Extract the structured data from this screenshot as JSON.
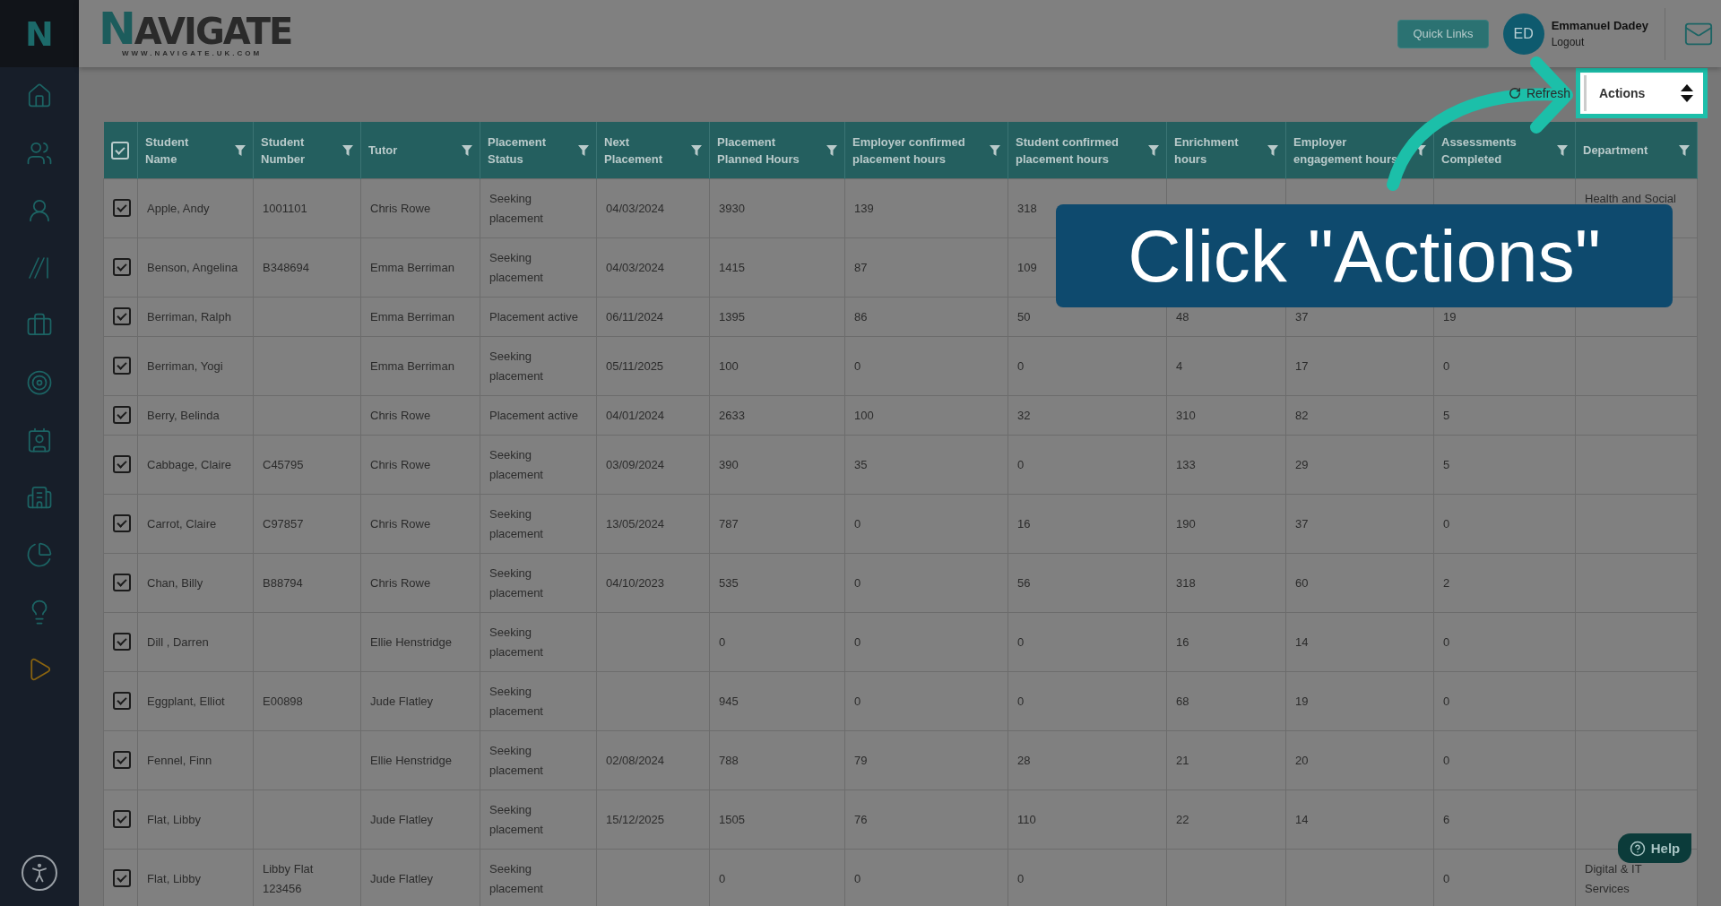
{
  "sidebar": {
    "logo": "N"
  },
  "header": {
    "logo": "NAVIGATE",
    "logo_url": "WWW.NAVIGATE.UK.COM",
    "quick_links": "Quick Links",
    "user": {
      "initials": "ED",
      "name": "Emmanuel Dadey",
      "logout": "Logout"
    }
  },
  "toolbar": {
    "refresh": "Refresh",
    "actions": "Actions"
  },
  "table": {
    "select_all_checked": true,
    "columns": [
      "Student Name",
      "Student Number",
      "Tutor",
      "Placement Status",
      "Next Placement",
      "Placement Planned Hours",
      "Employer confirmed placement hours",
      "Student confirmed placement hours",
      "Enrichment hours",
      "Employer engagement hours",
      "Assessments Completed",
      "Department"
    ],
    "rows": [
      {
        "checked": true,
        "cells": [
          "Apple, Andy",
          "1001101",
          "Chris Rowe",
          "Seeking placement",
          "04/03/2024",
          "3930",
          "139",
          "318",
          null,
          null,
          null,
          "Health and Social"
        ]
      },
      {
        "checked": true,
        "cells": [
          "Benson, Angelina",
          "B348694",
          "Emma Berriman",
          "Seeking placement",
          "04/03/2024",
          "1415",
          "87",
          "109",
          null,
          null,
          null,
          null
        ]
      },
      {
        "checked": true,
        "cells": [
          "Berriman, Ralph",
          null,
          "Emma Berriman",
          "Placement active",
          "06/11/2024",
          "1395",
          "86",
          "50",
          "48",
          "37",
          "19",
          null
        ]
      },
      {
        "checked": true,
        "cells": [
          "Berriman, Yogi",
          null,
          "Emma Berriman",
          "Seeking placement",
          "05/11/2025",
          "100",
          "0",
          "0",
          "4",
          "17",
          "0",
          null
        ]
      },
      {
        "checked": true,
        "cells": [
          "Berry, Belinda",
          null,
          "Chris Rowe",
          "Placement active",
          "04/01/2024",
          "2633",
          "100",
          "32",
          "310",
          "82",
          "5",
          null
        ]
      },
      {
        "checked": true,
        "cells": [
          "Cabbage, Claire",
          "C45795",
          "Chris Rowe",
          "Seeking placement",
          "03/09/2024",
          "390",
          "35",
          "0",
          "133",
          "29",
          "5",
          null
        ]
      },
      {
        "checked": true,
        "cells": [
          "Carrot, Claire",
          "C97857",
          "Chris Rowe",
          "Seeking placement",
          "13/05/2024",
          "787",
          "0",
          "16",
          "190",
          "37",
          "0",
          null
        ]
      },
      {
        "checked": true,
        "cells": [
          "Chan, Billy",
          "B88794",
          "Chris Rowe",
          "Seeking placement",
          "04/10/2023",
          "535",
          "0",
          "56",
          "318",
          "60",
          "2",
          null
        ]
      },
      {
        "checked": true,
        "cells": [
          "Dill , Darren",
          null,
          "Ellie Henstridge",
          "Seeking placement",
          null,
          "0",
          "0",
          "0",
          "16",
          "14",
          "0",
          null
        ]
      },
      {
        "checked": true,
        "cells": [
          "Eggplant, Elliot",
          "E00898",
          "Jude Flatley",
          "Seeking placement",
          null,
          "945",
          "0",
          "0",
          "68",
          "19",
          "0",
          null
        ]
      },
      {
        "checked": true,
        "cells": [
          "Fennel, Finn",
          null,
          "Ellie Henstridge",
          "Seeking placement",
          "02/08/2024",
          "788",
          "79",
          "28",
          "21",
          "20",
          "0",
          null
        ]
      },
      {
        "checked": true,
        "cells": [
          "Flat, Libby",
          null,
          "Jude Flatley",
          "Seeking placement",
          "15/12/2025",
          "1505",
          "76",
          "110",
          "22",
          "14",
          "6",
          null
        ]
      },
      {
        "checked": true,
        "cells": [
          "Flat, Libby",
          "Libby Flat 123456",
          "Jude Flatley",
          "Seeking placement",
          null,
          "0",
          "0",
          "0",
          null,
          null,
          "0",
          "Digital & IT Services"
        ]
      }
    ]
  },
  "help": "Help",
  "tutorial": {
    "callout": "Click \"Actions\""
  }
}
